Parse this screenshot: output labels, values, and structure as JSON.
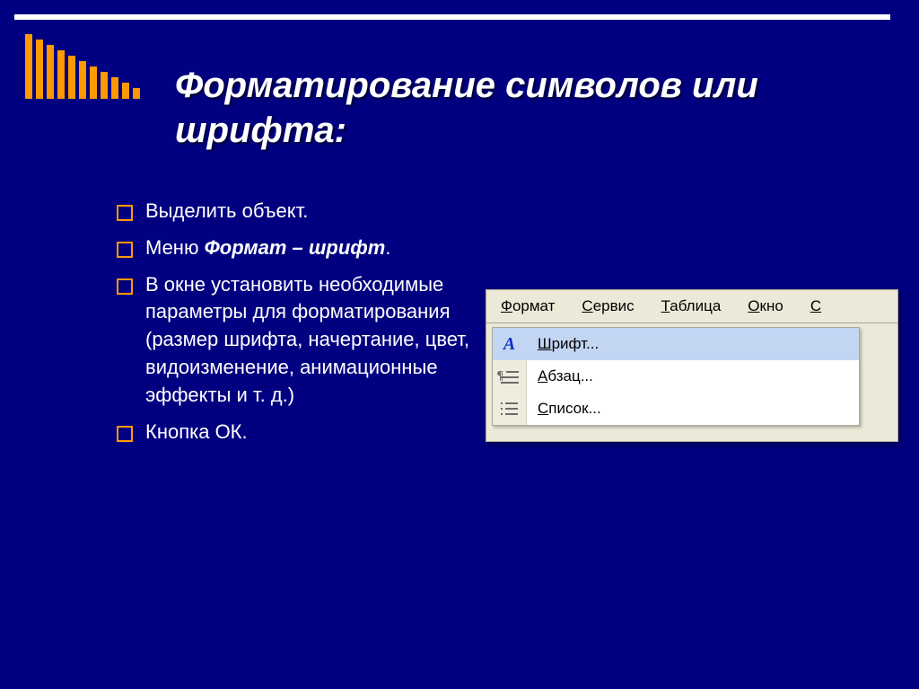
{
  "slide": {
    "title": "Форматирование символов или шрифта:",
    "bullets": [
      {
        "plain": "Выделить объект."
      },
      {
        "pre": "Меню ",
        "emph": "Формат – шрифт",
        "post": "."
      },
      {
        "plain": "В окне установить необходимые параметры для форматирования (размер шрифта, начертание, цвет, видоизменение, анимационные эффекты и т. д.)"
      },
      {
        "plain": "Кнопка ОК."
      }
    ]
  },
  "word_menu": {
    "menubar": [
      {
        "hot": "Ф",
        "rest": "ормат"
      },
      {
        "hot": "С",
        "rest": "ервис"
      },
      {
        "hot": "Т",
        "rest": "аблица"
      },
      {
        "hot": "О",
        "rest": "кно"
      },
      {
        "hot": "С",
        "rest": ""
      }
    ],
    "dropdown": [
      {
        "icon": "font",
        "hot": "Ш",
        "rest": "рифт...",
        "highlight": true
      },
      {
        "icon": "para",
        "hot": "А",
        "rest": "бзац...",
        "highlight": false
      },
      {
        "icon": "list",
        "hot": "С",
        "rest": "писок...",
        "highlight": false
      }
    ]
  }
}
